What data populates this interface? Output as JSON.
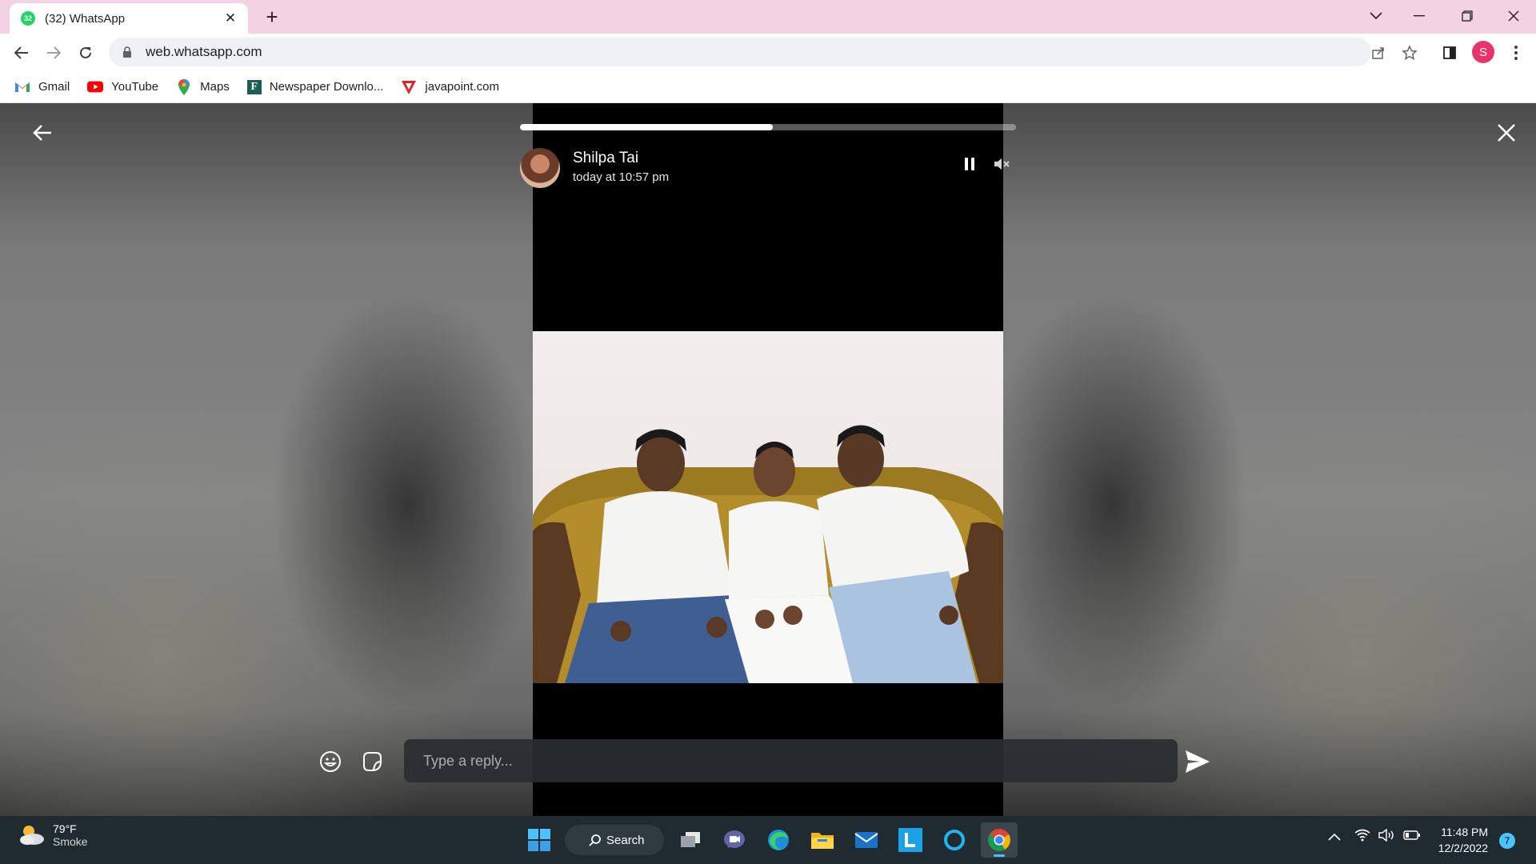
{
  "browser": {
    "tab_title": "(32) WhatsApp",
    "tab_badge": "32",
    "url": "web.whatsapp.com",
    "profile_initial": "S",
    "bookmarks": [
      {
        "label": "Gmail",
        "icon": "gmail-icon"
      },
      {
        "label": "YouTube",
        "icon": "youtube-icon"
      },
      {
        "label": "Maps",
        "icon": "maps-icon"
      },
      {
        "label": "Newspaper Downlo...",
        "icon": "newspaper-icon"
      },
      {
        "label": "javapoint.com",
        "icon": "javapoint-icon"
      }
    ]
  },
  "status": {
    "contact_name": "Shilpa Tai",
    "timestamp": "today at 10:57 pm",
    "progress": 0.51,
    "reply_placeholder": "Type a reply..."
  },
  "taskbar": {
    "temperature": "79°F",
    "weather_condition": "Smoke",
    "search_label": "Search",
    "time": "11:48 PM",
    "date": "12/2/2022",
    "notification_count": "7"
  },
  "colors": {
    "tabstrip": "#f3d2e3",
    "whatsapp_green": "#25d366",
    "profile_pink": "#e8336d",
    "taskbar": "#1f2a31"
  }
}
